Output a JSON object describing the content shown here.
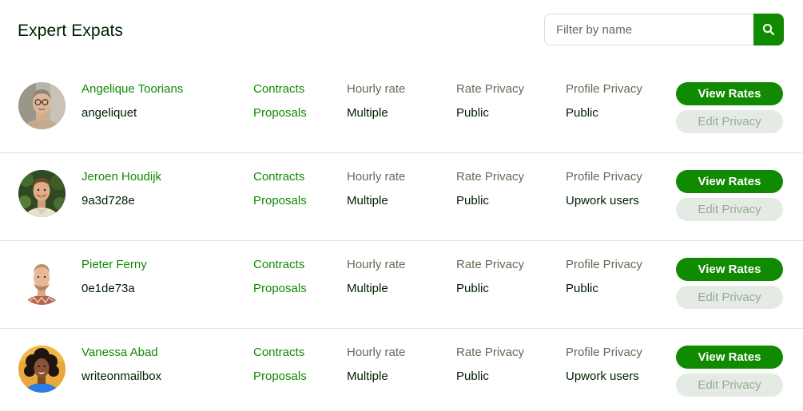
{
  "header": {
    "title": "Expert Expats",
    "search_placeholder": "Filter by name",
    "search_value": ""
  },
  "colors": {
    "brand_green": "#108a00",
    "text_dark": "#001e00",
    "muted_label": "#5e6d55",
    "disabled_bg": "#e4ebe4"
  },
  "labels": {
    "contracts": "Contracts",
    "proposals": "Proposals",
    "hourly_rate": "Hourly rate",
    "rate_privacy": "Rate Privacy",
    "profile_privacy": "Profile Privacy",
    "view_rates": "View Rates",
    "edit_privacy": "Edit Privacy"
  },
  "experts": [
    {
      "name": "Angelique Toorians",
      "username": "angeliquet",
      "hourly_rate": "Multiple",
      "rate_privacy": "Public",
      "profile_privacy": "Public",
      "avatar_icon": "person-glasses-photo"
    },
    {
      "name": "Jeroen Houdijk",
      "username": "9a3d728e",
      "hourly_rate": "Multiple",
      "rate_privacy": "Public",
      "profile_privacy": "Upwork users",
      "avatar_icon": "person-smiling-photo"
    },
    {
      "name": "Pieter Ferny",
      "username": "0e1de73a",
      "hourly_rate": "Multiple",
      "rate_privacy": "Public",
      "profile_privacy": "Public",
      "avatar_icon": "person-beard-photo"
    },
    {
      "name": "Vanessa Abad",
      "username": "writeonmailbox",
      "hourly_rate": "Multiple",
      "rate_privacy": "Public",
      "profile_privacy": "Upwork users",
      "avatar_icon": "person-curly-hair-photo"
    }
  ]
}
